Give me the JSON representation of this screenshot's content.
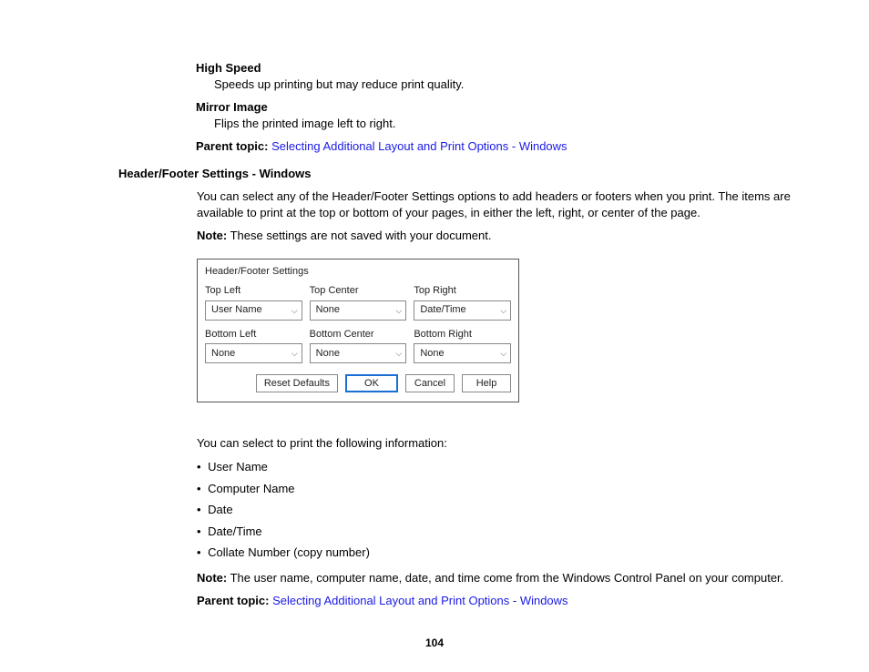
{
  "definitions": {
    "highSpeed": {
      "term": "High Speed",
      "text": "Speeds up printing but may reduce print quality."
    },
    "mirrorImage": {
      "term": "Mirror Image",
      "text": "Flips the printed image left to right."
    }
  },
  "parentTopic": {
    "label": "Parent topic:",
    "link": "Selecting Additional Layout and Print Options - Windows"
  },
  "section": {
    "heading": "Header/Footer Settings - Windows",
    "intro": "You can select any of the Header/Footer Settings options to add headers or footers when you print. The items are available to print at the top or bottom of your pages, in either the left, right, or center of the page."
  },
  "note1": {
    "label": "Note:",
    "text": " These settings are not saved with your document."
  },
  "dialog": {
    "title": "Header/Footer Settings",
    "fields": {
      "topLeft": {
        "label": "Top Left",
        "value": "User Name"
      },
      "topCenter": {
        "label": "Top Center",
        "value": "None"
      },
      "topRight": {
        "label": "Top Right",
        "value": "Date/Time"
      },
      "bottomLeft": {
        "label": "Bottom Left",
        "value": "None"
      },
      "bottomCenter": {
        "label": "Bottom Center",
        "value": "None"
      },
      "bottomRight": {
        "label": "Bottom Right",
        "value": "None"
      }
    },
    "buttons": {
      "reset": "Reset Defaults",
      "ok": "OK",
      "cancel": "Cancel",
      "help": "Help"
    }
  },
  "listIntro": "You can select to print the following information:",
  "listItems": {
    "0": "User Name",
    "1": "Computer Name",
    "2": "Date",
    "3": "Date/Time",
    "4": "Collate Number (copy number)"
  },
  "note2": {
    "label": "Note:",
    "text": " The user name, computer name, date, and time come from the Windows Control Panel on your computer."
  },
  "pageNumber": "104"
}
